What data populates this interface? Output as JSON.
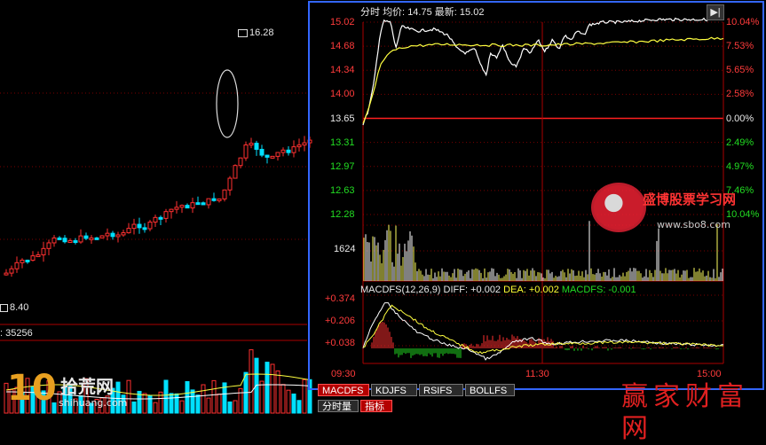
{
  "left_panel": {
    "high_label": "16.28",
    "low_label": "8.40",
    "volume_label": ": 35256"
  },
  "intraday": {
    "header": {
      "prefix": "分时",
      "avg_label": "均价:",
      "avg_value": "14.75",
      "last_label": "最新:",
      "last_value": "15.02"
    },
    "price_ticks": [
      "15.02",
      "14.68",
      "14.34",
      "14.00",
      "13.65",
      "13.31",
      "12.97",
      "12.63",
      "12.28"
    ],
    "pct_ticks": [
      "10.04%",
      "7.53%",
      "5.65%",
      "2.58%",
      "0.00%",
      "2.49%",
      "4.97%",
      "7.46%",
      "10.04%"
    ],
    "volume_tick": "1624",
    "macd_header": {
      "name": "MACDFS(12,26,9)",
      "diff": "DIFF: +0.002",
      "dea": "DEA: +0.002",
      "macd": "MACDFS: -0.001"
    },
    "macd_ticks": [
      "+0.374",
      "+0.206",
      "+0.038"
    ],
    "time_labels": [
      "09:30",
      "11:30",
      "15:00"
    ],
    "tabs": [
      {
        "label": "MACDFS",
        "active": true
      },
      {
        "label": "KDJFS",
        "active": false
      },
      {
        "label": "RSIFS",
        "active": false
      },
      {
        "label": "BOLLFS",
        "active": false
      }
    ],
    "bottom_tabs": [
      {
        "label": "分时量",
        "active": false
      },
      {
        "label": "指标",
        "active": true
      }
    ]
  },
  "watermarks": {
    "brand_cn": "盛博股票学习网",
    "brand_url": "www.sbo8.com",
    "corner_num": "10",
    "corner_cn": "拾荒网",
    "corner_url": "shihuang.com",
    "footer_cn": "赢家财富网"
  },
  "colors": {
    "up": "#ff3030",
    "down": "#00e0ff",
    "border": "#3366ff",
    "avg_line": "#ffff40",
    "price_line": "#ffffff"
  }
}
